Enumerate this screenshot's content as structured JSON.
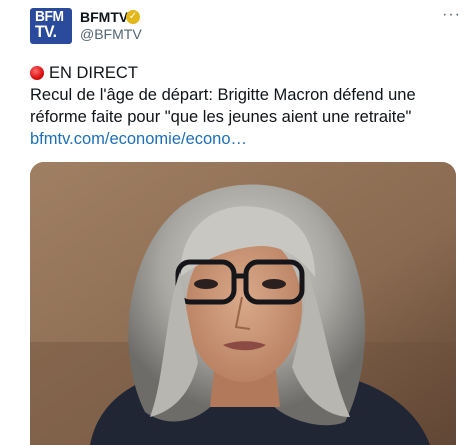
{
  "account": {
    "avatar_text_line1": "BFM",
    "avatar_text_line2": "TV.",
    "display_name": "BFMTV",
    "handle": "@BFMTV",
    "verified_icon": "verified-badge-icon",
    "more_icon": "more-dots-icon"
  },
  "tweet": {
    "live_label": "EN DIRECT",
    "live_icon": "red-circle-icon",
    "line1": "Recul de l'âge de départ: Brigitte Macron défend une",
    "line2": "réforme faite pour \"que les jeunes aient une retraite\"",
    "link": "bfmtv.com/economie/econo…"
  },
  "colors": {
    "brand_blue": "#2a4b9c",
    "link": "#1d6fb8",
    "verified_gold": "#e2b719"
  }
}
